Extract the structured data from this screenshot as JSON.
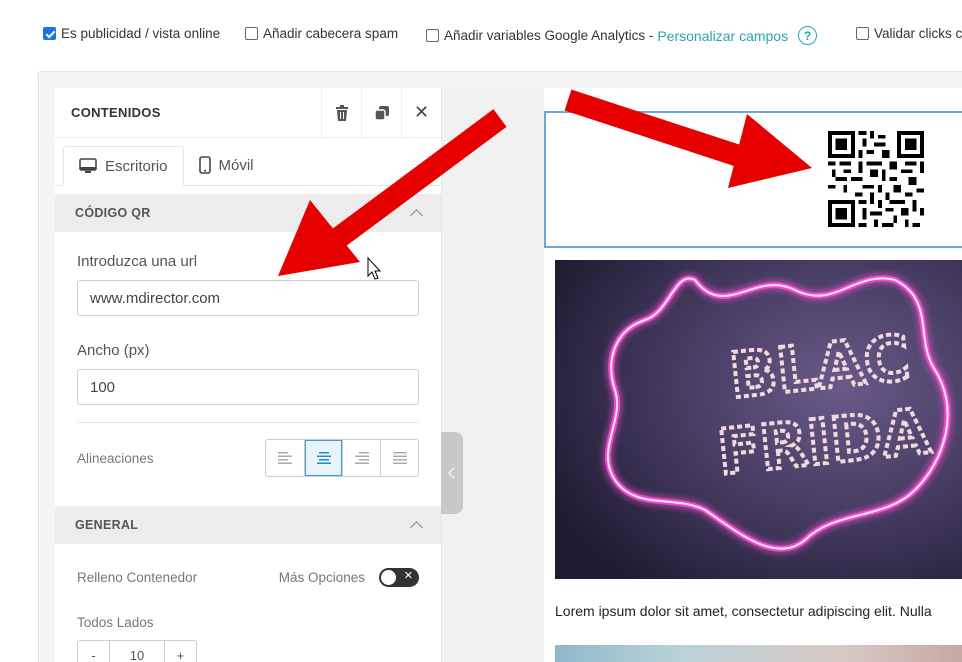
{
  "topbar": {
    "options": [
      {
        "label": "Es publicidad / vista online",
        "checked": true
      },
      {
        "label": "Añadir cabecera spam",
        "checked": false
      },
      {
        "label": "Añadir variables Google Analytics -",
        "checked": false
      },
      {
        "label": "Validar clicks c",
        "checked": false
      }
    ],
    "customize_link": "Personalizar campos",
    "help_symbol": "?"
  },
  "panel": {
    "title": "CONTENIDOS",
    "header_icons": [
      "trash-icon",
      "duplicate-icon",
      "close-icon"
    ],
    "close_symbol": "✕",
    "tabs": [
      {
        "label": "Escritorio",
        "icon": "desktop-icon",
        "active": true
      },
      {
        "label": "Móvil",
        "icon": "mobile-icon",
        "active": false
      }
    ],
    "qr_section": {
      "title": "CÓDIGO QR",
      "url_label": "Introduzca una url",
      "url_value": "www.mdirector.com",
      "width_label": "Ancho (px)",
      "width_value": "100",
      "align_label": "Alineaciones",
      "align_options": [
        "align-left",
        "align-center",
        "align-right",
        "align-justify"
      ],
      "align_selected": "align-center"
    },
    "general_section": {
      "title": "GENERAL",
      "padding_label": "Relleno Contenedor",
      "more_options_label": "Más Opciones",
      "more_options_on": false,
      "all_sides_label": "Todos Lados",
      "stepper_minus": "-",
      "stepper_value": "10",
      "stepper_plus": "+"
    }
  },
  "preview": {
    "hero_text_line1": "BLAC",
    "hero_text_line2": "FRIDA",
    "body_text": "Lorem ipsum dolor sit amet, consectetur adipiscing elit. Nulla"
  },
  "colors": {
    "accent": "#2aa2b5",
    "checkbox": "#1a73e8",
    "selection": "#6aaad8",
    "arrow": "#e60000"
  }
}
